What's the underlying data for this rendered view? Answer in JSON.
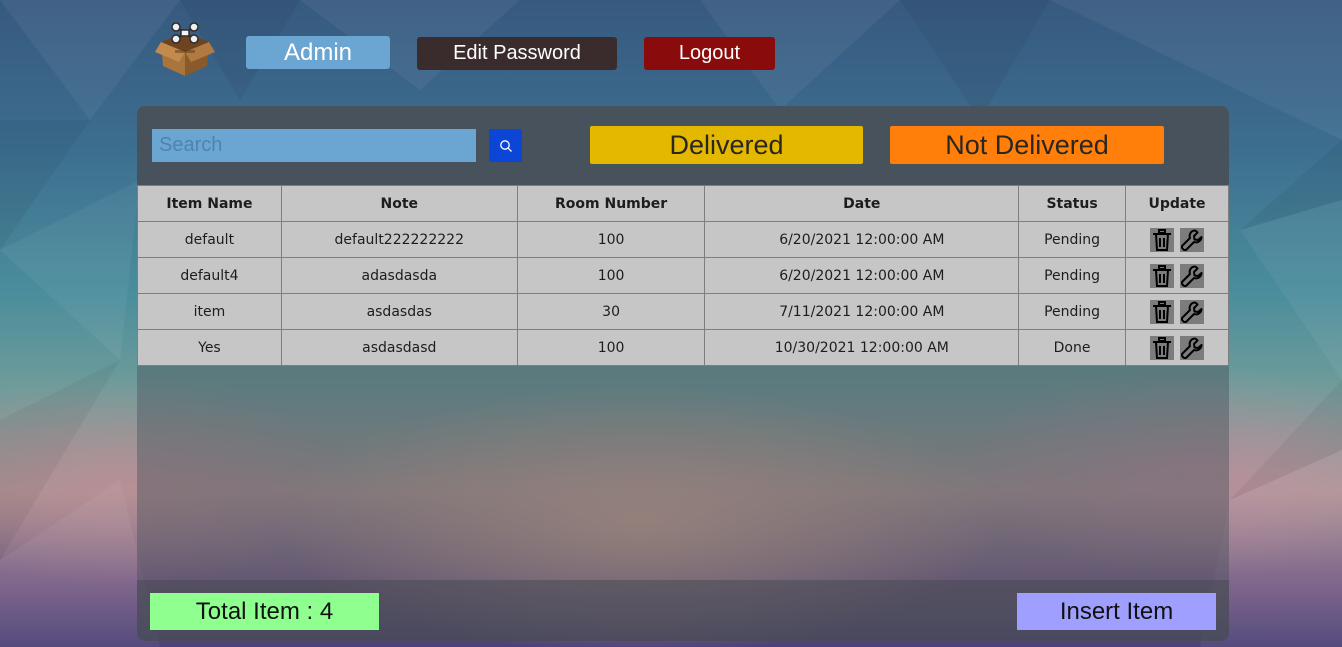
{
  "header": {
    "admin_label": "Admin",
    "edit_password_label": "Edit Password",
    "logout_label": "Logout"
  },
  "search": {
    "placeholder": "Search",
    "value": ""
  },
  "filters": {
    "delivered_label": "Delivered",
    "not_delivered_label": "Not Delivered"
  },
  "table": {
    "columns": [
      "Item Name",
      "Note",
      "Room Number",
      "Date",
      "Status",
      "Update"
    ],
    "rows": [
      {
        "item_name": "default",
        "note": "default222222222",
        "room_number": "100",
        "date": "6/20/2021 12:00:00 AM",
        "status": "Pending"
      },
      {
        "item_name": "default4",
        "note": "adasdasda",
        "room_number": "100",
        "date": "6/20/2021 12:00:00 AM",
        "status": "Pending"
      },
      {
        "item_name": "item",
        "note": "asdasdas",
        "room_number": "30",
        "date": "7/11/2021 12:00:00 AM",
        "status": "Pending"
      },
      {
        "item_name": "Yes",
        "note": "asdasdasd",
        "room_number": "100",
        "date": "10/30/2021 12:00:00 AM",
        "status": "Done"
      }
    ],
    "row_icons": [
      "trash-icon",
      "wrench-icon"
    ]
  },
  "footer": {
    "total_label": "Total Item : 4",
    "insert_label": "Insert Item"
  },
  "colors": {
    "admin": "#6ba6d2",
    "edit_password": "#3a2c2c",
    "logout": "#8a0b0b",
    "delivered": "#e5b800",
    "not_delivered": "#ff7f0a",
    "search_button": "#0c46d6",
    "total": "#8fff8f",
    "insert": "#9f9fff"
  }
}
